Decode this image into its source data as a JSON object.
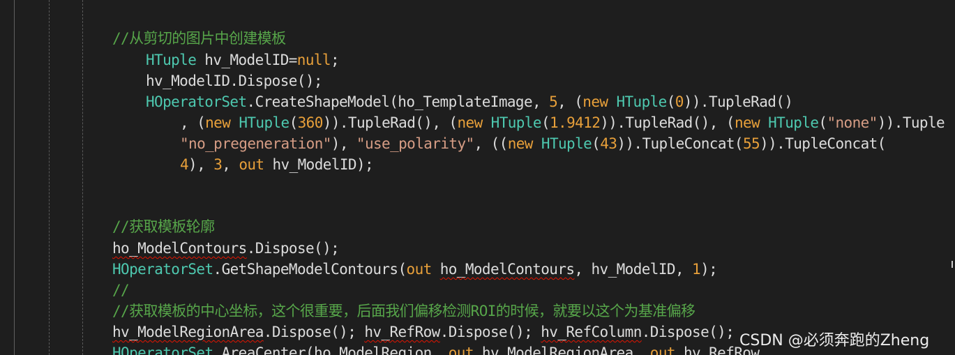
{
  "code_lines": [
    [
      {
        "t": "//从剪切的图片中创建模板",
        "c": "comment"
      }
    ],
    [
      {
        "t": "HTuple",
        "c": "type"
      },
      {
        "t": " hv_ModelID=",
        "c": "plain"
      },
      {
        "t": "null",
        "c": "kwo"
      },
      {
        "t": ";",
        "c": "plain"
      }
    ],
    [
      {
        "t": "hv_ModelID.Dispose();",
        "c": "plain"
      }
    ],
    [
      {
        "t": "HOperatorSet",
        "c": "type"
      },
      {
        "t": ".CreateShapeModel(ho_TemplateImage, ",
        "c": "plain"
      },
      {
        "t": "5",
        "c": "num"
      },
      {
        "t": ", (",
        "c": "plain"
      },
      {
        "t": "new",
        "c": "kwo"
      },
      {
        "t": " ",
        "c": "plain"
      },
      {
        "t": "HTuple",
        "c": "type"
      },
      {
        "t": "(",
        "c": "plain"
      },
      {
        "t": "0",
        "c": "num"
      },
      {
        "t": ")).TupleRad()",
        "c": "plain"
      }
    ],
    [
      {
        "t": ", (",
        "c": "plain"
      },
      {
        "t": "new",
        "c": "kwo"
      },
      {
        "t": " ",
        "c": "plain"
      },
      {
        "t": "HTuple",
        "c": "type"
      },
      {
        "t": "(",
        "c": "plain"
      },
      {
        "t": "360",
        "c": "num"
      },
      {
        "t": ")).TupleRad(), (",
        "c": "plain"
      },
      {
        "t": "new",
        "c": "kwo"
      },
      {
        "t": " ",
        "c": "plain"
      },
      {
        "t": "HTuple",
        "c": "type"
      },
      {
        "t": "(",
        "c": "plain"
      },
      {
        "t": "1.9412",
        "c": "num"
      },
      {
        "t": ")).TupleRad(), (",
        "c": "plain"
      },
      {
        "t": "new",
        "c": "kwo"
      },
      {
        "t": " ",
        "c": "plain"
      },
      {
        "t": "HTuple",
        "c": "type"
      },
      {
        "t": "(",
        "c": "plain"
      },
      {
        "t": "\"none\"",
        "c": "str"
      },
      {
        "t": ")).Tuple",
        "c": "plain"
      }
    ],
    [
      {
        "t": "\"no_pregeneration\"",
        "c": "str"
      },
      {
        "t": "), ",
        "c": "plain"
      },
      {
        "t": "\"use_polarity\"",
        "c": "str"
      },
      {
        "t": ", ((",
        "c": "plain"
      },
      {
        "t": "new",
        "c": "kwo"
      },
      {
        "t": " ",
        "c": "plain"
      },
      {
        "t": "HTuple",
        "c": "type"
      },
      {
        "t": "(",
        "c": "plain"
      },
      {
        "t": "43",
        "c": "num"
      },
      {
        "t": ")).TupleConcat(",
        "c": "plain"
      },
      {
        "t": "55",
        "c": "num"
      },
      {
        "t": ")).TupleConcat(",
        "c": "plain"
      }
    ],
    [
      {
        "t": "4",
        "c": "num"
      },
      {
        "t": "), ",
        "c": "plain"
      },
      {
        "t": "3",
        "c": "num"
      },
      {
        "t": ", ",
        "c": "plain"
      },
      {
        "t": "out",
        "c": "kwo"
      },
      {
        "t": " hv_ModelID);",
        "c": "plain"
      }
    ],
    [
      {
        "t": "//获取模板轮廓",
        "c": "comment"
      }
    ],
    [
      {
        "t": "ho_ModelContours",
        "c": "plain",
        "sq": true
      },
      {
        "t": ".Dispose();",
        "c": "plain"
      }
    ],
    [
      {
        "t": "HOperatorSet",
        "c": "type"
      },
      {
        "t": ".GetShapeModelContours(",
        "c": "plain"
      },
      {
        "t": "out",
        "c": "kwo"
      },
      {
        "t": " ",
        "c": "plain"
      },
      {
        "t": "ho_ModelContours",
        "c": "plain",
        "sq": true
      },
      {
        "t": ", hv_ModelID, ",
        "c": "plain"
      },
      {
        "t": "1",
        "c": "num"
      },
      {
        "t": ");",
        "c": "plain"
      }
    ],
    [
      {
        "t": "//",
        "c": "comment"
      }
    ],
    [
      {
        "t": "//获取模板的中心坐标，这个很重要，后面我们偏移检测ROI的时候，就要以这个为基准偏移",
        "c": "comment"
      }
    ],
    [
      {
        "t": "hv_ModelRegionArea",
        "c": "plain",
        "sq": true
      },
      {
        "t": ".Dispose(); ",
        "c": "plain"
      },
      {
        "t": "hv_RefRow",
        "c": "plain",
        "sq": true
      },
      {
        "t": ".Dispose(); ",
        "c": "plain"
      },
      {
        "t": "hv_RefColumn",
        "c": "plain",
        "sq": true
      },
      {
        "t": ".Dispose();",
        "c": "plain"
      }
    ],
    [
      {
        "t": "HOperatorSet",
        "c": "type"
      },
      {
        "t": ".AreaCenter(ho_ModelRegion, ",
        "c": "plain"
      },
      {
        "t": "out",
        "c": "kwo"
      },
      {
        "t": " hv_ModelRegionArea, ",
        "c": "plain"
      },
      {
        "t": "out",
        "c": "kwo"
      },
      {
        "t": " hv_RefRow,",
        "c": "plain"
      }
    ]
  ],
  "watermark": "CSDN @必须奔跑的Zheng"
}
